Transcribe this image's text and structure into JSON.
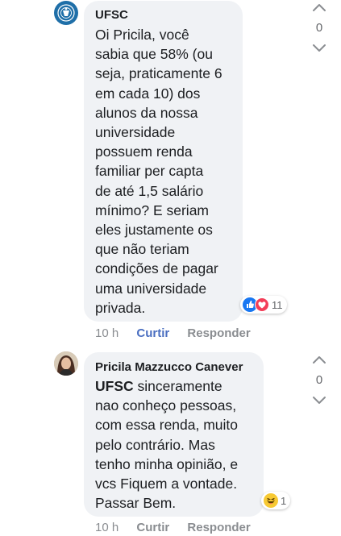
{
  "comments": [
    {
      "author": "UFSC",
      "avatar_icon": "ufsc-logo-icon",
      "text": "Oi Pricila, você\nsabia que 58% (ou\nseja, praticamente 6\nem cada 10) dos\nalunos da nossa\nuniversidade\npossuem renda\nfamiliar per capta\nde até 1,5 salário\nmínimo? E seriam\neles justamente os\nque não teriam\ncondições de pagar\numa universidade\nprivada.",
      "reactions": {
        "icons": [
          "like-icon",
          "love-icon"
        ],
        "count": "11"
      },
      "time": "10 h",
      "like_label": "Curtir",
      "reply_label": "Responder",
      "vote_count": "0"
    },
    {
      "author": "Pricila Mazzucco Canever",
      "avatar_icon": "user-avatar-photo",
      "mention": "UFSC",
      "text": " sinceramente\nnao conheço pessoas,\ncom essa renda, muito\npelo contrário.  Mas\ntenho minha opinião,  e\nvcs Fiquem a vontade.\nPassar Bem.",
      "reactions": {
        "icons": [
          "haha-icon"
        ],
        "count": "1"
      },
      "time": "10 h",
      "like_label": "Curtir",
      "reply_label": "Responder",
      "vote_count": "0"
    }
  ],
  "colors": {
    "bubble": "#f0f2f5",
    "link": "#4b6fc1",
    "meta": "#8a8d91",
    "ufsc_blue": "#1f6fa8"
  }
}
